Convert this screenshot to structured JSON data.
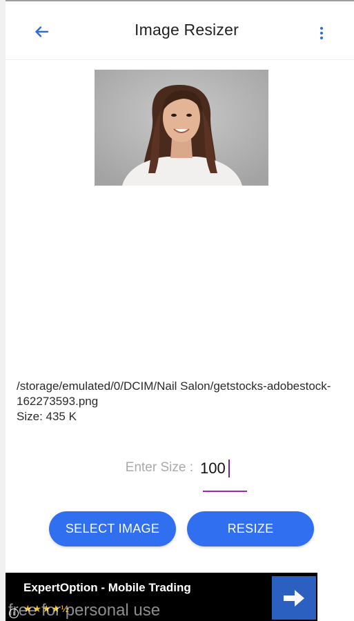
{
  "appbar": {
    "title": "Image Resizer",
    "back_icon": "back-arrow-icon",
    "menu_icon": "more-vertical-icon"
  },
  "file": {
    "path": "/storage/emulated/0/DCIM/Nail Salon/getstocks-adobestock-162273593.png",
    "size_text": "Size: 435 K"
  },
  "resize": {
    "label": "Enter Size :",
    "value": "100"
  },
  "buttons": {
    "select_label": "SELECT IMAGE",
    "resize_label": "RESIZE"
  },
  "ad": {
    "title": "ExpertOption - Mobile Trading",
    "stars": "★★★★½",
    "arrow_icon": "arrow-right-icon",
    "info_icon": "info-icon"
  },
  "watermark": "free for personal use",
  "colors": {
    "accent": "#2f6ff0",
    "icon_blue": "#2d6bd6",
    "input_underline": "#9c27b0",
    "ad_background": "#000000"
  }
}
